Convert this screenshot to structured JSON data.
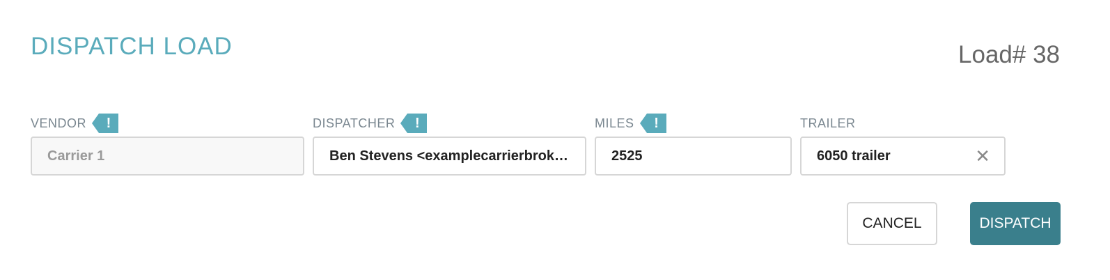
{
  "dialog": {
    "title": "DISPATCH LOAD",
    "load_number": "Load# 38"
  },
  "fields": {
    "vendor": {
      "label": "VENDOR",
      "value": "Carrier 1",
      "warning_icon": "exclamation-icon",
      "disabled": true
    },
    "dispatcher": {
      "label": "DISPATCHER",
      "value": "Ben Stevens <examplecarrierbrok…",
      "warning_icon": "exclamation-icon"
    },
    "miles": {
      "label": "MILES",
      "value": "2525",
      "warning_icon": "exclamation-icon"
    },
    "trailer": {
      "label": "TRAILER",
      "value": "6050 trailer",
      "clear_icon": "close-icon"
    }
  },
  "actions": {
    "cancel_label": "CANCEL",
    "dispatch_label": "DISPATCH"
  },
  "warning_glyph": "!",
  "clear_glyph": "✕",
  "colors": {
    "title": "#5aabbb",
    "warning_flag": "#5aabbb",
    "dispatch_button": "#3a7f8c",
    "label": "#7a8790",
    "border": "#d6d6d6"
  }
}
